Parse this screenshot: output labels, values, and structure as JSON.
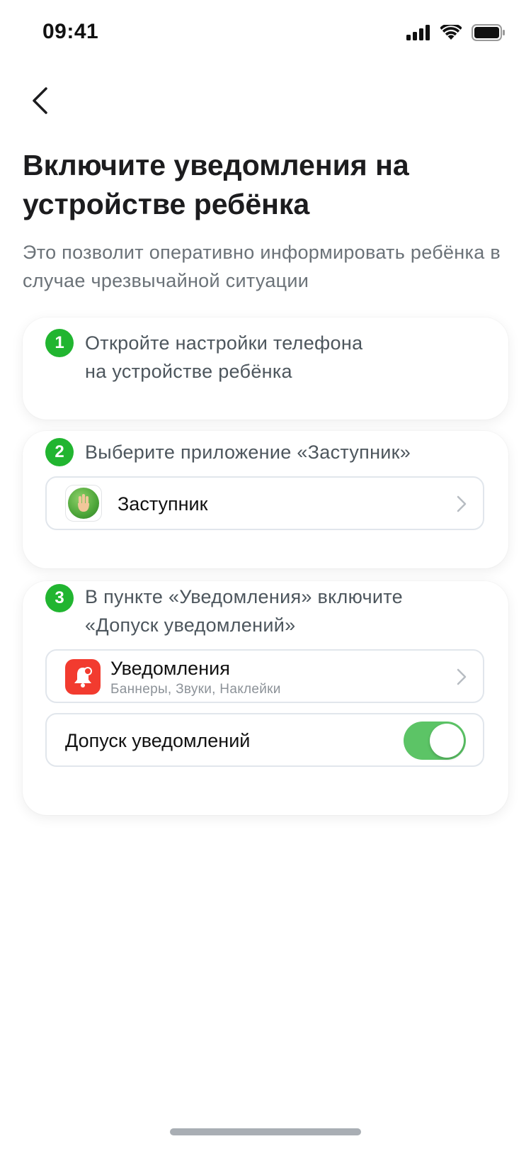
{
  "status_bar": {
    "time": "09:41"
  },
  "header": {
    "title": "Включите уведомления на устройстве ребёнка",
    "subtitle": "Это позволит оперативно информировать ребёнка в случае чрезвычайной ситуации"
  },
  "steps": [
    {
      "number": "1",
      "text_line1": "Откройте настройки телефона",
      "text_line2": "на устройстве ребёнка"
    },
    {
      "number": "2",
      "text_line1": "Выберите приложение «Заступник»",
      "app_row": {
        "label": "Заступник",
        "icon": "raised-hand-app-icon"
      }
    },
    {
      "number": "3",
      "text_line1": "В пункте «Уведомления» включите",
      "text_line2": "«Допуск уведомлений»",
      "notifications_row": {
        "title": "Уведомления",
        "subtitle": "Баннеры, Звуки, Наклейки",
        "icon": "bell-icon"
      },
      "toggle_row": {
        "label": "Допуск уведомлений",
        "enabled": true
      }
    }
  ],
  "colors": {
    "accent_green": "#21b530",
    "toggle_on": "#5cc466",
    "notification_red": "#f23b2f"
  }
}
